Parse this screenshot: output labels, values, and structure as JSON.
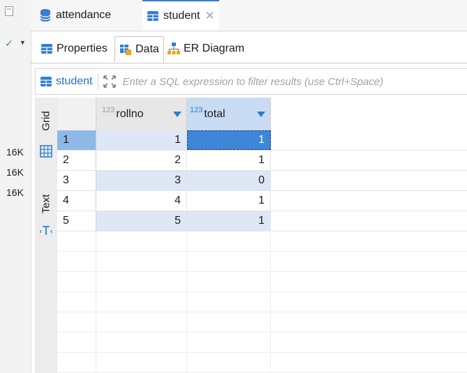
{
  "sidebar": {
    "size_labels": [
      "16K",
      "16K",
      "16K"
    ]
  },
  "tabs": [
    {
      "label": "attendance",
      "icon": "database-icon"
    },
    {
      "label": "student",
      "icon": "table-icon",
      "closable": true
    }
  ],
  "sub_tabs": [
    {
      "label": "Properties",
      "icon": "table-icon"
    },
    {
      "label": "Data",
      "icon": "data-icon",
      "active": true
    },
    {
      "label": "ER Diagram",
      "icon": "er-diagram-icon"
    }
  ],
  "filter": {
    "entity": "student",
    "placeholder": "Enter a SQL expression to filter results (use Ctrl+Space)"
  },
  "panel_tabs": {
    "grid": "Grid",
    "text": "Text"
  },
  "grid": {
    "columns": [
      {
        "name": "rollno",
        "type_badge": "123"
      },
      {
        "name": "total",
        "type_badge": "123"
      }
    ],
    "rows": [
      {
        "num": "1",
        "rollno": "1",
        "total": "1"
      },
      {
        "num": "2",
        "rollno": "2",
        "total": "1"
      },
      {
        "num": "3",
        "rollno": "3",
        "total": "0"
      },
      {
        "num": "4",
        "rollno": "4",
        "total": "1"
      },
      {
        "num": "5",
        "rollno": "5",
        "total": "1"
      }
    ]
  },
  "colors": {
    "accent": "#2e7bd4",
    "selected_cell": "#3d86d8",
    "alt_row": "#dde7f5"
  }
}
